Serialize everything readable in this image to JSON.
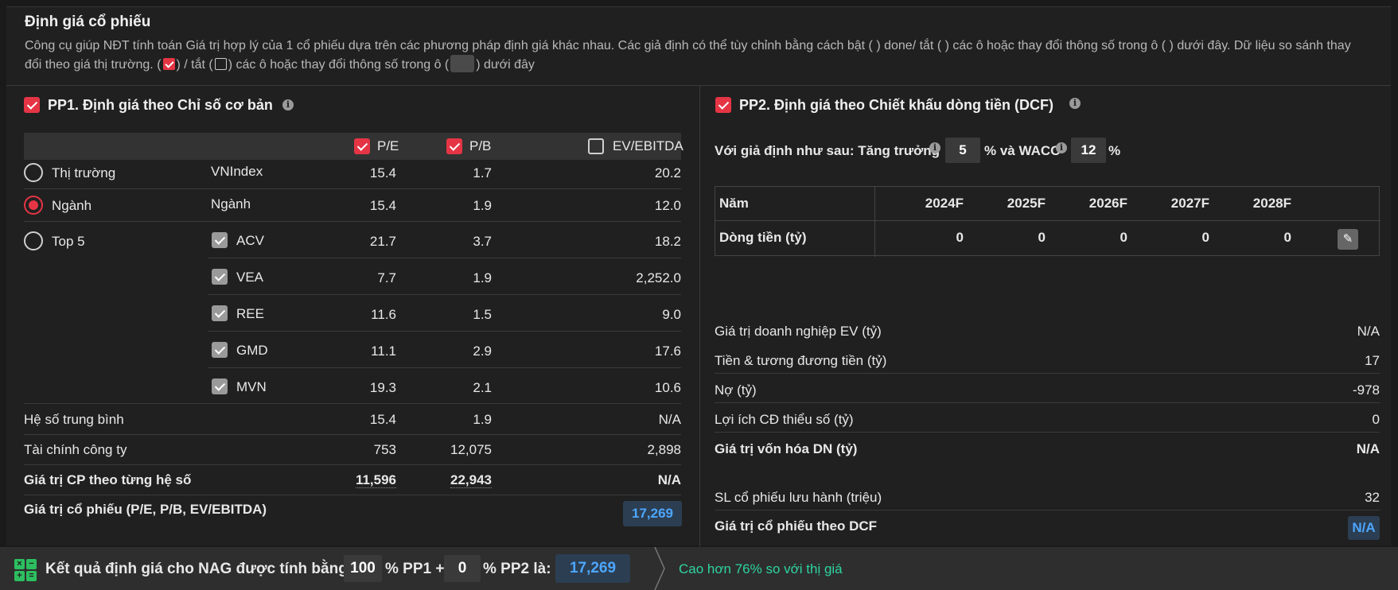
{
  "header": {
    "title": "Định giá cổ phiếu",
    "desc_part1": "Công cụ giúp NĐT tính toán Giá trị hợp lý của 1 cổ phiếu dựa trên các phương pháp định giá khác nhau. Các giả định có thể tùy chỉnh bằng cách bật ( ) done/ tắt ( ) các ô hoặc thay đổi thông số trong ô ( ) dưới đây. Dữ liệu so sánh thay đổi theo giá thị trường. (",
    "desc_part2": ") / tắt (",
    "desc_part3": ") các ô hoặc thay đổi thông số trong ô (",
    "desc_part4": ") dưới đây"
  },
  "pp1": {
    "title": "PP1. Định giá theo Chỉ số cơ bản",
    "columns": [
      {
        "label": "P/E",
        "checked": true
      },
      {
        "label": "P/B",
        "checked": true
      },
      {
        "label": "EV/EBITDA",
        "checked": false
      }
    ],
    "rows": [
      {
        "group": "Thị trường",
        "name": "VNIndex",
        "pe": "15.4",
        "pb": "1.7",
        "ev": "20.2"
      },
      {
        "group": "Ngành",
        "name": "Ngành",
        "pe": "15.4",
        "pb": "1.9",
        "ev": "12.0"
      },
      {
        "group": "Top 5",
        "name": "ACV",
        "pe": "21.7",
        "pb": "3.7",
        "ev": "18.2"
      },
      {
        "group": "",
        "name": "VEA",
        "pe": "7.7",
        "pb": "1.9",
        "ev": "2,252.0"
      },
      {
        "group": "",
        "name": "REE",
        "pe": "11.6",
        "pb": "1.5",
        "ev": "9.0"
      },
      {
        "group": "",
        "name": "GMD",
        "pe": "11.1",
        "pb": "2.9",
        "ev": "17.6"
      },
      {
        "group": "",
        "name": "MVN",
        "pe": "19.3",
        "pb": "2.1",
        "ev": "10.6"
      }
    ],
    "avg": {
      "label": "Hệ số trung bình",
      "pe": "15.4",
      "pb": "1.9",
      "ev": "N/A"
    },
    "fin": {
      "label": "Tài chính công ty",
      "pe": "753",
      "pb": "12,075",
      "ev": "2,898"
    },
    "price_each": {
      "label": "Giá trị CP theo từng hệ số",
      "pe": "11,596",
      "pb": "22,943",
      "ev": "N/A"
    },
    "result": {
      "label": "Giá trị cổ phiếu (P/E, P/B, EV/EBITDA)",
      "value": "17,269"
    }
  },
  "pp2": {
    "title": "PP2. Định giá theo Chiết khấu dòng tiền (DCF)",
    "assume_label": "Với giả định như sau: Tăng trưởng",
    "growth": "5",
    "wacc_label": "% và WACC",
    "wacc": "12",
    "pct": "%",
    "table": {
      "year_label": "Năm",
      "years": [
        "2024F",
        "2025F",
        "2026F",
        "2027F",
        "2028F"
      ],
      "cf_label": "Dòng tiền (tỷ)",
      "cf": [
        "0",
        "0",
        "0",
        "0",
        "0"
      ]
    },
    "items": [
      {
        "label": "Giá trị doanh nghiệp EV (tỷ)",
        "value": "N/A"
      },
      {
        "label": "Tiền & tương đương tiền (tỷ)",
        "value": "17"
      },
      {
        "label": "Nợ (tỷ)",
        "value": "-978"
      },
      {
        "label": "Lợi ích CĐ thiểu số (tỷ)",
        "value": "0"
      },
      {
        "label": "Giá trị vốn hóa DN (tỷ)",
        "value": "N/A"
      }
    ],
    "shares": {
      "label": "SL cổ phiếu lưu hành (triệu)",
      "value": "32"
    },
    "result": {
      "label": "Giá trị cổ phiếu theo DCF",
      "value": "N/A"
    }
  },
  "footer": {
    "text1": "Kết quả định giá cho NAG được tính bằng",
    "pp1_pct": "100",
    "text2": "% PP1 +",
    "pp2_pct": "0",
    "text3": "% PP2 là:",
    "result": "17,269",
    "note": "Cao hơn 76% so với thị giá",
    "note_color": "#2dd4a0",
    "accent": "#e53545",
    "link_color": "#4da6ff"
  }
}
